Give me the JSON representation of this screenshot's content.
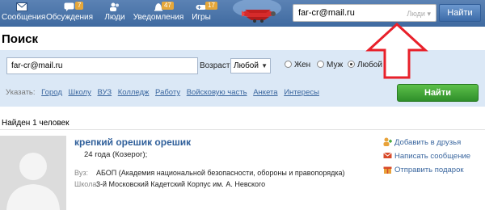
{
  "nav": {
    "items": [
      {
        "label": "Сообщения",
        "icon": "envelope-icon",
        "badge": ""
      },
      {
        "label": "Обсуждения",
        "icon": "chat-icon",
        "badge": "7"
      },
      {
        "label": "Люди",
        "icon": "people-icon",
        "badge": ""
      },
      {
        "label": "Уведомления",
        "icon": "bell-icon",
        "badge": "47"
      },
      {
        "label": "Игры",
        "icon": "gamepad-icon",
        "badge": "17"
      }
    ],
    "search_value": "far-cr@mail.ru",
    "search_scope": "Люди",
    "search_button": "Найти"
  },
  "page_title": "Поиск",
  "filters": {
    "query": "far-cr@mail.ru",
    "age_label": "Возраст",
    "age_value": "Любой",
    "gender_options": [
      {
        "label": "Жен",
        "selected": false
      },
      {
        "label": "Муж",
        "selected": false
      },
      {
        "label": "Любой",
        "selected": true
      }
    ],
    "refine_label": "Указать:",
    "refine_links": [
      "Город",
      "Школу",
      "ВУЗ",
      "Колледж",
      "Работу",
      "Войсковую часть",
      "Анкета",
      "Интересы"
    ],
    "find_button": "Найти"
  },
  "results": {
    "count_text": "Найден 1 человек",
    "person": {
      "name": "крепкий орешик орешик",
      "age": "24 года (Козерог);",
      "university_label": "Вуз:",
      "university": "АБОП (Академия национальной безопасности, обороны и правопорядка)",
      "school_label": "Школа:",
      "school": "3-й Московский Кадетский Корпус им. А. Невского"
    },
    "actions": [
      {
        "label": "Добавить в друзья",
        "icon": "add-friend-icon"
      },
      {
        "label": "Написать сообщение",
        "icon": "message-icon"
      },
      {
        "label": "Отправить подарок",
        "icon": "gift-icon"
      }
    ]
  },
  "colors": {
    "nav_bar": "#4a74aa",
    "panel": "#dbe8f6",
    "link": "#3b679f",
    "find_button": "#3da234",
    "arrow": "#e8202a"
  }
}
